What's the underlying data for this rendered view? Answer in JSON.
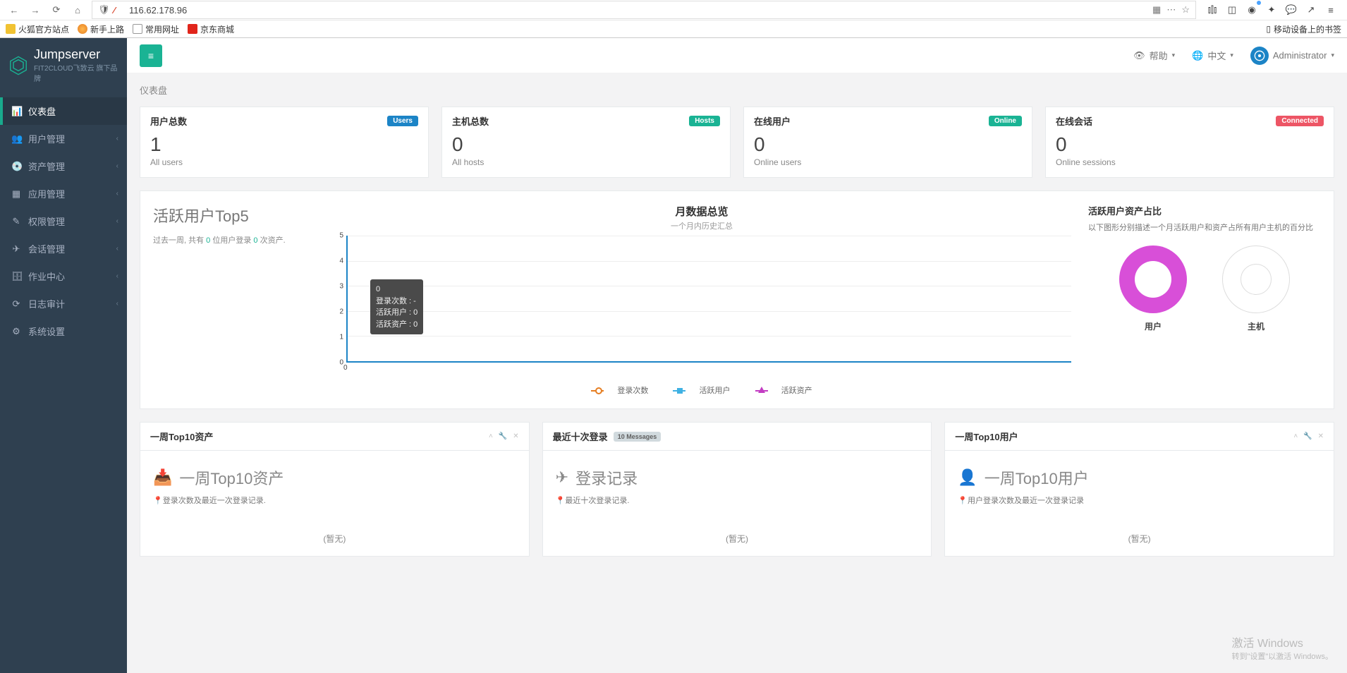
{
  "browser": {
    "url": "116.62.178.96",
    "bookmarks": [
      "火狐官方站点",
      "新手上路",
      "常用网址",
      "京东商城"
    ],
    "mobile_bookmarks": "移动设备上的书签"
  },
  "brand": {
    "name": "Jumpserver",
    "sub": "FIT2CLOUD飞致云 旗下品牌"
  },
  "topbar": {
    "help": "帮助",
    "lang": "中文",
    "user": "Administrator"
  },
  "breadcrumb": "仪表盘",
  "sidebar": {
    "items": [
      {
        "label": "仪表盘",
        "active": true
      },
      {
        "label": "用户管理",
        "expand": true
      },
      {
        "label": "资产管理",
        "expand": true
      },
      {
        "label": "应用管理",
        "expand": true
      },
      {
        "label": "权限管理",
        "expand": true
      },
      {
        "label": "会话管理",
        "expand": true
      },
      {
        "label": "作业中心",
        "expand": true
      },
      {
        "label": "日志审计",
        "expand": true
      },
      {
        "label": "系统设置"
      }
    ]
  },
  "stats": [
    {
      "title": "用户总数",
      "badge": "Users",
      "badge_cls": "b-users",
      "value": "1",
      "sub": "All users"
    },
    {
      "title": "主机总数",
      "badge": "Hosts",
      "badge_cls": "b-hosts",
      "value": "0",
      "sub": "All hosts"
    },
    {
      "title": "在线用户",
      "badge": "Online",
      "badge_cls": "b-online",
      "value": "0",
      "sub": "Online users"
    },
    {
      "title": "在线会话",
      "badge": "Connected",
      "badge_cls": "b-conn",
      "value": "0",
      "sub": "Online sessions"
    }
  ],
  "top5": {
    "title": "活跃用户Top5",
    "desc_pre": "过去一周, 共有 ",
    "users": "0",
    "desc_mid": " 位用户登录 ",
    "assets": "0",
    "desc_post": " 次资产."
  },
  "tooltip": {
    "title": "0",
    "l1": "登录次数 : -",
    "l2": "活跃用户 : 0",
    "l3": "活跃资产 : 0"
  },
  "legend": {
    "a": "登录次数",
    "b": "活跃用户",
    "c": "活跃资产"
  },
  "donut": {
    "title": "活跃用户资产占比",
    "desc": "以下图形分别描述一个月活跃用户和资产占所有用户主机的百分比",
    "user": "用户",
    "host": "主机"
  },
  "panels": {
    "p1": {
      "title": "一周Top10资产",
      "h2": "一周Top10资产",
      "meta": "登录次数及最近一次登录记录.",
      "empty": "(暂无)"
    },
    "p2": {
      "title": "最近十次登录",
      "badge": "10 Messages",
      "h2": "登录记录",
      "meta": "最近十次登录记录.",
      "empty": "(暂无)"
    },
    "p3": {
      "title": "一周Top10用户",
      "h2": "一周Top10用户",
      "meta": "用户登录次数及最近一次登录记录",
      "empty": "(暂无)"
    }
  },
  "watermark": {
    "line1": "激活 Windows",
    "line2": "转到\"设置\"以激活 Windows。"
  },
  "chart_data": {
    "type": "line",
    "title": "月数据总览",
    "subtitle": "一个月内历史汇总",
    "x": [
      0
    ],
    "ylim": [
      0,
      5
    ],
    "yticks": [
      0,
      1,
      2,
      3,
      4,
      5
    ],
    "series": [
      {
        "name": "登录次数",
        "values": [
          null
        ]
      },
      {
        "name": "活跃用户",
        "values": [
          0
        ]
      },
      {
        "name": "活跃资产",
        "values": [
          0
        ]
      }
    ]
  }
}
